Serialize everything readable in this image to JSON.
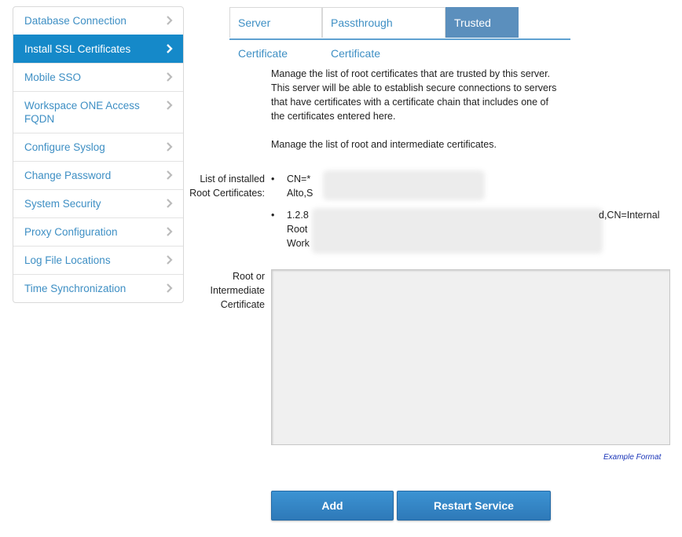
{
  "sidebar": {
    "items": [
      {
        "label": "Database Connection",
        "active": false
      },
      {
        "label": "Install SSL Certificates",
        "active": true
      },
      {
        "label": "Mobile SSO",
        "active": false
      },
      {
        "label": "Workspace ONE Access FQDN",
        "active": false
      },
      {
        "label": "Configure Syslog",
        "active": false
      },
      {
        "label": "Change Password",
        "active": false
      },
      {
        "label": "System Security",
        "active": false
      },
      {
        "label": "Proxy Configuration",
        "active": false
      },
      {
        "label": "Log File Locations",
        "active": false
      },
      {
        "label": "Time Synchronization",
        "active": false
      }
    ],
    "chevron_icon": "chevron-right-icon"
  },
  "tabs": [
    {
      "label": "Server Certificate",
      "active": false
    },
    {
      "label": "Passthrough Certificate",
      "active": false
    },
    {
      "label": "Trusted CAs",
      "active": true
    }
  ],
  "description": {
    "p1": "Manage the list of root certificates that are trusted by this server. This server will be able to establish secure connections to servers that have certificates with a certificate chain that includes one of the certificates entered here.",
    "p2": "Manage the list of root and intermediate certificates."
  },
  "form": {
    "installed_label": "List of installed Root Certificates:",
    "root_label": "Root or Intermediate Certificate",
    "textarea_value": "",
    "example_link": "Example Format"
  },
  "certificates": [
    {
      "lines": [
        "CN=*",
        "Alto,S"
      ]
    },
    {
      "lines": [
        "1.2.8",
        "Root",
        "Work"
      ],
      "tail": "d,CN=Internal"
    }
  ],
  "buttons": {
    "add": "Add",
    "restart": "Restart Service"
  },
  "colors": {
    "accent": "#1589c9",
    "link": "#3e8fc4",
    "active_tab": "#5b8fbd",
    "button": "#2e79b8"
  }
}
